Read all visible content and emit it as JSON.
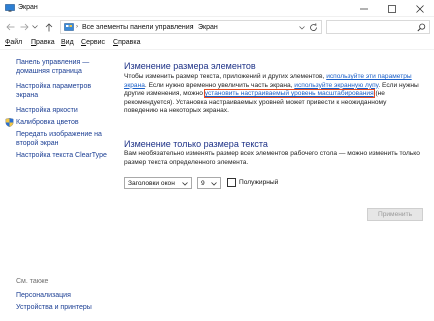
{
  "window": {
    "title": "Экран"
  },
  "address": {
    "crumbs": [
      "Все элементы панели управления",
      "Экран"
    ]
  },
  "menu": {
    "items": [
      {
        "label": "Файл",
        "underline": "Ф",
        "rest": "айл"
      },
      {
        "label": "Правка",
        "underline": "П",
        "rest": "равка"
      },
      {
        "label": "Вид",
        "underline": "В",
        "rest": "ид"
      },
      {
        "label": "Сервис",
        "underline": "С",
        "rest": "ервис"
      },
      {
        "label": "Справка",
        "underline": "С",
        "rest": "правка"
      }
    ]
  },
  "sidebar": {
    "home_line1": "Панель управления —",
    "home_line2": "домашняя страница",
    "adjust_line1": "Настройка параметров",
    "adjust_line2": "экрана",
    "brightness": "Настройка яркости",
    "calibrate": "Калибровка цветов",
    "project_line1": "Передать изображение на",
    "project_line2": "второй экран",
    "cleartype": "Настройка текста ClearType",
    "see_also": "См. также",
    "personalization": "Персонализация",
    "devices": "Устройства и принтеры"
  },
  "main": {
    "heading1": "Изменение размера элементов",
    "p1_a": "Чтобы изменить размер текста, приложений и других элементов, ",
    "p1_link1": "используйте эти параметры экрана",
    "p1_b": ". Если нужно временно увеличить часть экрана, ",
    "p1_link2": "используйте экранную лупу",
    "p1_c": ". Если нужны другие изменения, можно ",
    "p1_link3": "установить настраиваемый уровень масштабирования",
    "p1_d": " (не рекомендуется). Установка настраиваемых уровней может привести к неожиданному поведению на некоторых экранах.",
    "heading2": "Изменение только размера текста",
    "p2": "Вам необязательно изменять размер всех элементов рабочего стола — можно изменить только размер текста определенного элемента.",
    "element_select": "Заголовки окон",
    "size_select": "9",
    "bold_label": "Полужирный",
    "apply": "Применить"
  }
}
